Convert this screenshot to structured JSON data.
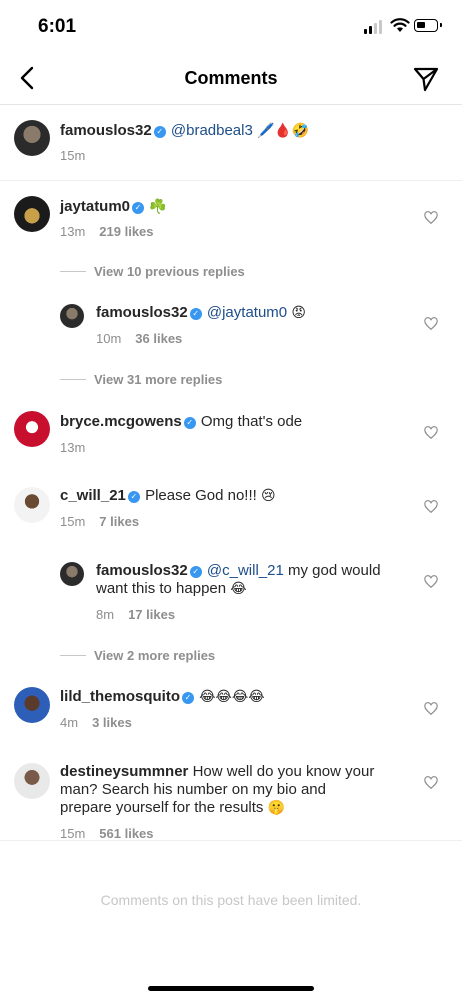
{
  "status": {
    "time": "6:01"
  },
  "header": {
    "title": "Comments"
  },
  "caption": {
    "user": "famouslos32",
    "mention": "@bradbeal3",
    "emojis": "🖊️🩸🤣",
    "time": "15m"
  },
  "comments": [
    {
      "user": "jaytatum0",
      "text": "",
      "emojis": "☘️",
      "time": "13m",
      "likes": "219 likes"
    },
    {
      "view_more": "View 10 previous replies"
    },
    {
      "user": "famouslos32",
      "mention": "@jaytatum0",
      "emojis": "😡",
      "time": "10m",
      "likes": "36 likes"
    },
    {
      "view_more": "View 31 more replies"
    },
    {
      "user": "bryce.mcgowens",
      "text": "Omg that's ode",
      "time": "13m"
    },
    {
      "user": "c_will_21",
      "text": "Please God no!!!",
      "emojis": "😢",
      "time": "15m",
      "likes": "7 likes"
    },
    {
      "user": "famouslos32",
      "mention": "@c_will_21",
      "text": "my god would",
      "text2": "want this to happen",
      "emojis": "😂",
      "time": "8m",
      "likes": "17 likes"
    },
    {
      "view_more": "View 2 more replies"
    },
    {
      "user": "lild_themosquito",
      "emojis": "😂😂😂😂",
      "time": "4m",
      "likes": "3 likes"
    },
    {
      "user": "destineysummner",
      "text": "How well do you know your",
      "text2": "man?  Search his number on my bio and",
      "text3": "prepare yourself for the results",
      "emojis": "🤫",
      "time": "15m",
      "likes": "561 likes"
    }
  ],
  "footer": {
    "limited": "Comments on this post have been limited."
  },
  "colors": {
    "verified": "#3897f0",
    "mention": "#1d4e89",
    "meta": "#8e8e8e"
  }
}
